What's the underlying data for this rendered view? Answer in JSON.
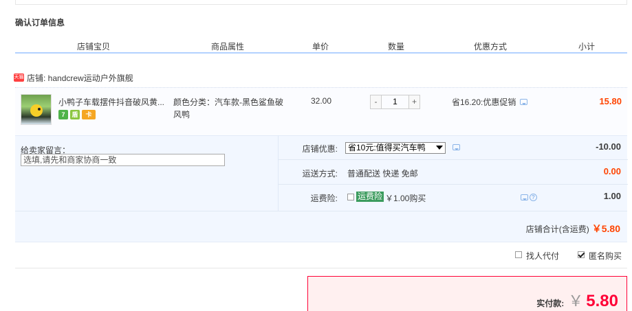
{
  "title": "确认订单信息",
  "columns": [
    "店铺宝贝",
    "商品属性",
    "单价",
    "数量",
    "优惠方式",
    "小计"
  ],
  "shop": {
    "badge": "天猫",
    "name": "店铺: handcrew运动户外旗舰"
  },
  "item": {
    "title": "小鸭子车载摆件抖音破风黄...",
    "service_icons": [
      "7",
      "盾",
      "卡"
    ],
    "attribute": "颜色分类：汽车款-黑色鲨鱼破风鸭",
    "unit_price": "32.00",
    "quantity": "1",
    "qty_minus": "-",
    "qty_plus": "+",
    "promo": "省16.20:优惠促销",
    "subtotal": "15.80"
  },
  "message": {
    "label": "给卖家留言：",
    "placeholder": "选填,请先和商家协商一致"
  },
  "options": {
    "coupon_label": "店铺优惠:",
    "coupon_value": "省10元:值得买汽车鸭",
    "coupon_amount": "-10.00",
    "shipping_label": "运送方式:",
    "shipping_value": "普通配送 快递 免邮",
    "shipping_amount": "0.00",
    "insurance_label": "运费险:",
    "insurance_tag": "运费险",
    "insurance_text": "￥1.00购买",
    "insurance_amount": "1.00"
  },
  "shop_total": {
    "label": "店铺合计(含运费)",
    "value": "￥5.80"
  },
  "agent": {
    "pay_for_me": "找人代付",
    "anonymous": "匿名购买",
    "anonymous_checked": true
  },
  "payment": {
    "label": "实付款:",
    "yen": "￥",
    "value": "5.80"
  }
}
